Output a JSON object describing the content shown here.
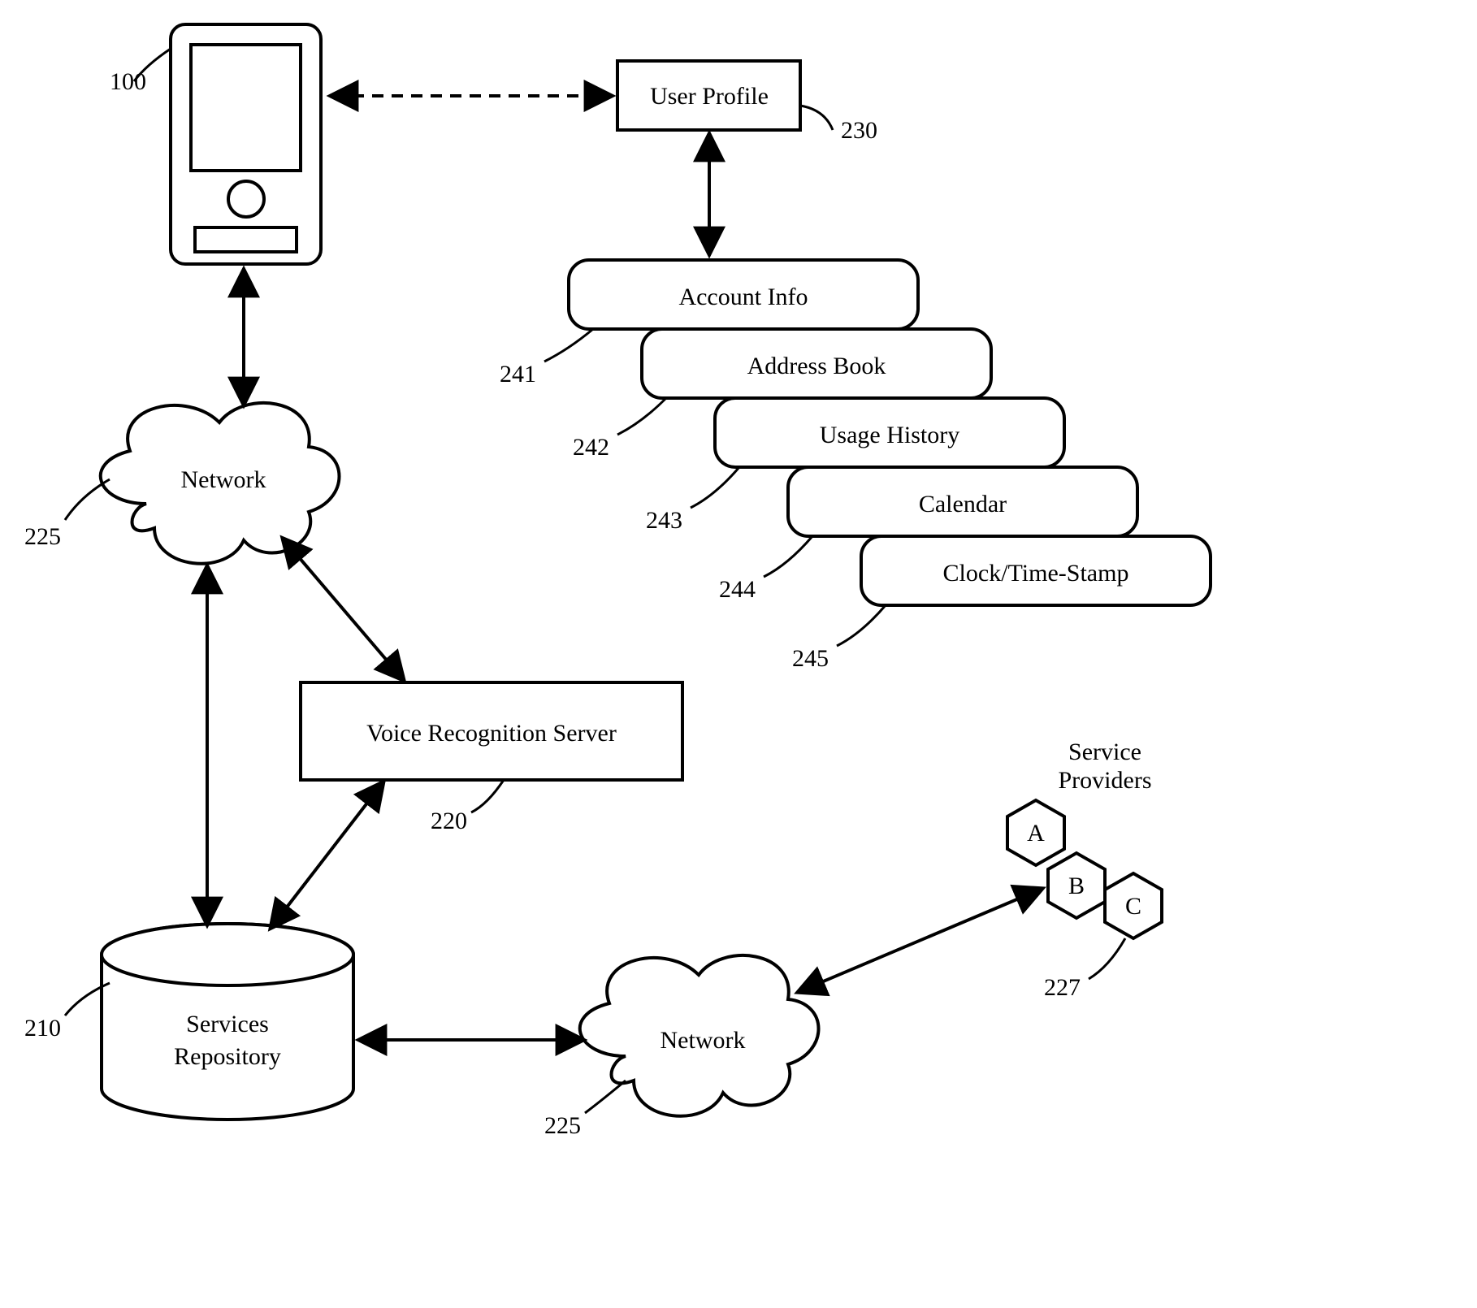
{
  "diagram": {
    "phone_ref": "100",
    "user_profile": "User Profile",
    "user_profile_ref": "230",
    "account_info": "Account Info",
    "account_info_ref": "241",
    "address_book": "Address Book",
    "address_book_ref": "242",
    "usage_history": "Usage History",
    "usage_history_ref": "243",
    "calendar": "Calendar",
    "calendar_ref": "244",
    "clock_timestamp": "Clock/Time-Stamp",
    "clock_timestamp_ref": "245",
    "network1": "Network",
    "network1_ref": "225",
    "voice_server": "Voice Recognition Server",
    "voice_server_ref": "220",
    "services_repo_l1": "Services",
    "services_repo_l2": "Repository",
    "services_repo_ref": "210",
    "network2": "Network",
    "network2_ref": "225",
    "service_providers_l1": "Service",
    "service_providers_l2": "Providers",
    "sp_a": "A",
    "sp_b": "B",
    "sp_c": "C",
    "sp_ref": "227"
  }
}
